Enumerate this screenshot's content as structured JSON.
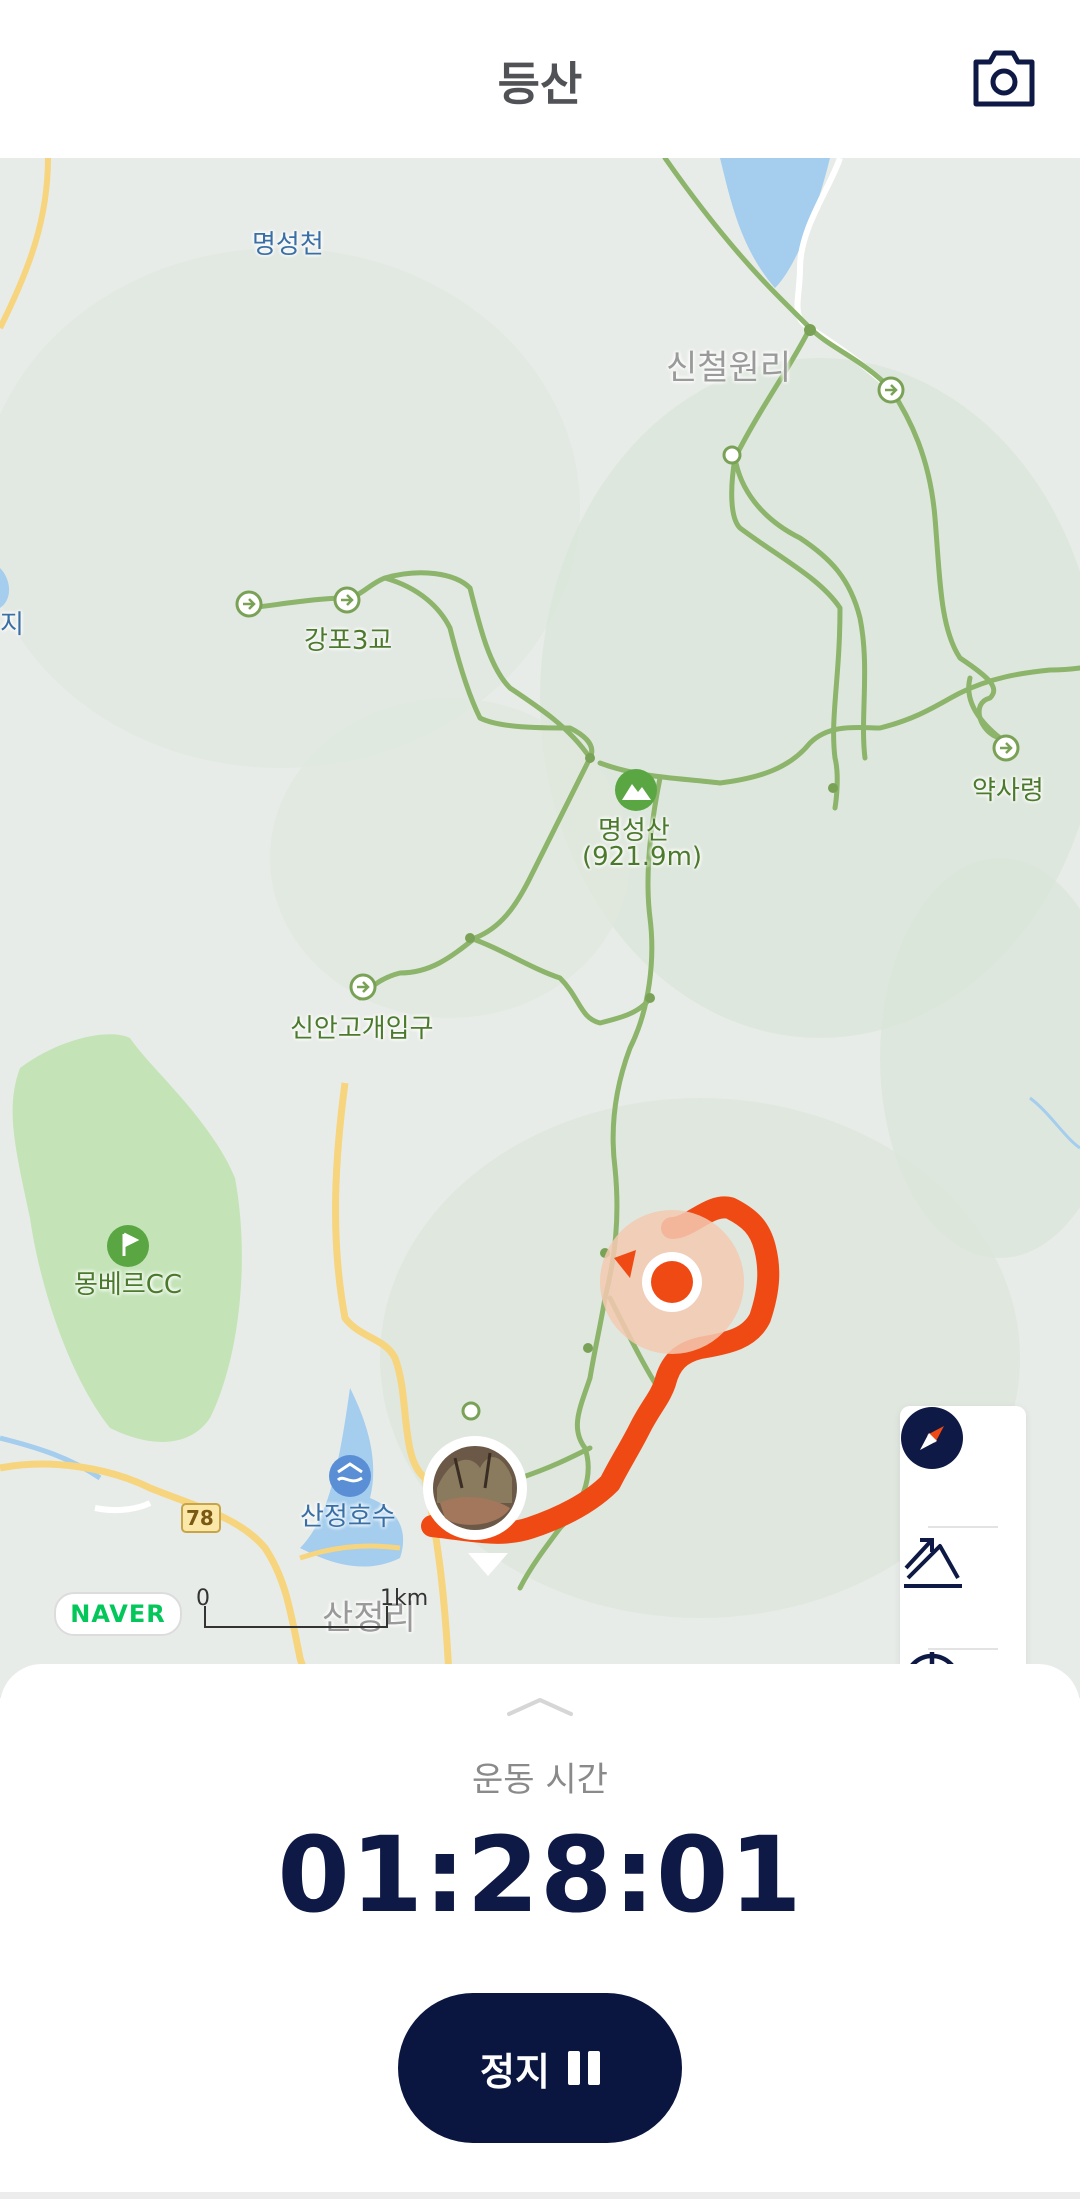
{
  "header": {
    "title": "등산",
    "camera_icon": "camera-icon"
  },
  "map": {
    "labels": {
      "myeongseongcheon": "명성천",
      "sincheolwonri": "신철원리",
      "gangpo3gyo": "강포3교",
      "myeongseongsan": "명성산",
      "myeongseongsan_elev": "(921.9m)",
      "yaksaryeong": "약사령",
      "sinangogae": "신안고개입구",
      "mongbereu_cc": "몽베르CC",
      "sanjeong_lake": "산정호수",
      "sanjeongri": "산정리",
      "route_78": "78",
      "left_edge_partial": "지"
    },
    "naver_logo": "NAVER",
    "scale": {
      "start": "0",
      "end": "1km"
    },
    "colors": {
      "track": "#f04a14",
      "trail": "#8cb46a",
      "water": "#a4cdee",
      "park": "#c4e4b8",
      "road": "#f6d57e"
    }
  },
  "controls": {
    "compass_icon": "compass-icon",
    "route_icon": "route-climb-icon",
    "location_icon": "crosshair-icon"
  },
  "sheet": {
    "label": "운동 시간",
    "time": "01:28:01",
    "stop_label": "정지"
  }
}
